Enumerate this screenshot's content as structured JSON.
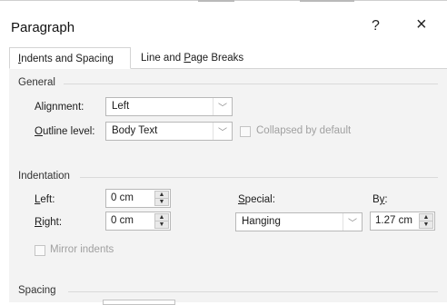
{
  "dialog": {
    "title": "Paragraph",
    "help_glyph": "?",
    "close_glyph": "×"
  },
  "tabs": [
    {
      "label_pre": "",
      "label_ul": "I",
      "label_post": "ndents and Spacing"
    },
    {
      "label_pre": "Line and ",
      "label_ul": "P",
      "label_post": "age Breaks"
    }
  ],
  "general": {
    "heading": "General",
    "alignment_label": "Alignment:",
    "alignment_value": "Left",
    "outline_label_ul": "O",
    "outline_label_rest": "utline level:",
    "outline_value": "Body Text",
    "collapsed_label": "Collapsed by default"
  },
  "indentation": {
    "heading": "Indentation",
    "left_label_pre": "",
    "left_label_ul": "L",
    "left_label_post": "eft:",
    "left_value": "0 cm",
    "right_label_ul": "R",
    "right_label_post": "ight:",
    "right_value": "0 cm",
    "special_label_ul": "S",
    "special_label_post": "pecial:",
    "special_value": "Hanging",
    "by_label_pre": "B",
    "by_label_ul": "y",
    "by_label_post": ":",
    "by_value": "1.27 cm",
    "mirror_label": "Mirror indents"
  },
  "spacing": {
    "heading": "Spacing"
  },
  "icons": {
    "up": "▲",
    "down": "▼",
    "chevron": "﹀"
  }
}
